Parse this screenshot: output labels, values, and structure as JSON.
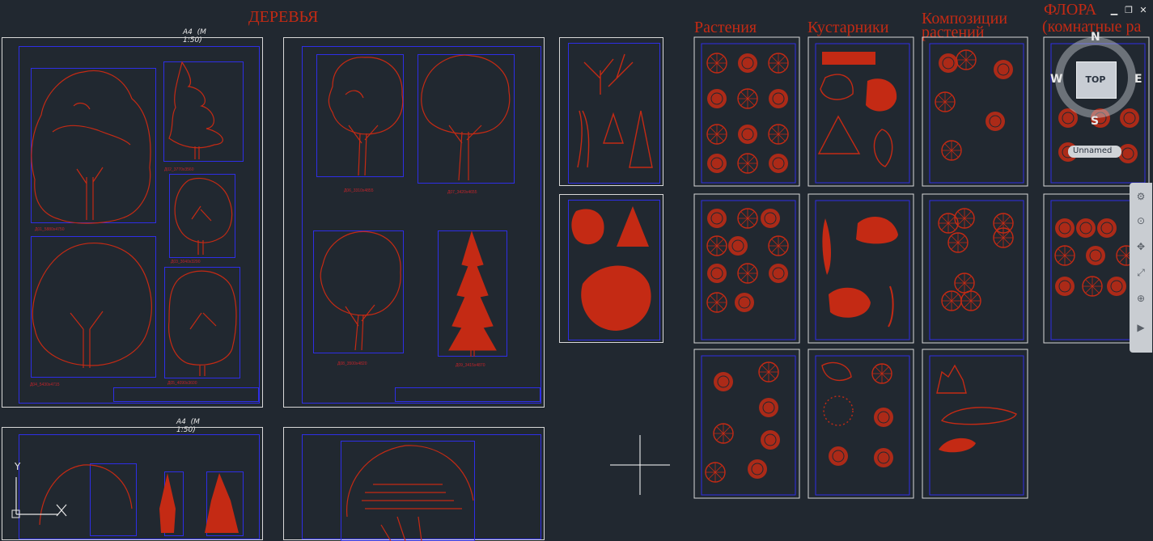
{
  "titles": {
    "trees": "ДЕРЕВЬЯ",
    "plants": "Растения",
    "shrubs": "Кустарники",
    "compositions_1": "Композиции",
    "compositions_2": "растений",
    "flora_1": "ФЛОРА",
    "flora_2": "(комнатные ра"
  },
  "sheet_labels": {
    "a4_scale": "A4  (M\n1:50)"
  },
  "tree_captions": {
    "d1": "Д01_5880х4750",
    "d2": "Д02_3770х3560",
    "d3": "Д03_3040х3290",
    "d4": "Д04_5430х4715",
    "d5": "Д05_4090х3600",
    "d6": "Д06_3310х4855",
    "d7": "Д07_3420х4655",
    "d8": "Д08_3500х4820",
    "d9": "Д09_3415х4870"
  },
  "viewcube": {
    "north": "N",
    "south": "S",
    "east": "E",
    "west": "W",
    "face": "TOP",
    "ucs": "Unnamed"
  },
  "ucs_icon": {
    "y_axis": "Y"
  },
  "window_controls": {
    "minimize": "▁",
    "restore": "❐",
    "close": "✕"
  },
  "navbar": [
    "⚙",
    "⊙",
    "✥",
    "⤢",
    "⊕",
    "▶"
  ],
  "colors": {
    "background": "#212830",
    "drawing": "#c42a14",
    "frame": "#2e2ee6",
    "sheet": "#d8d8d8",
    "label": "#c0242a"
  }
}
